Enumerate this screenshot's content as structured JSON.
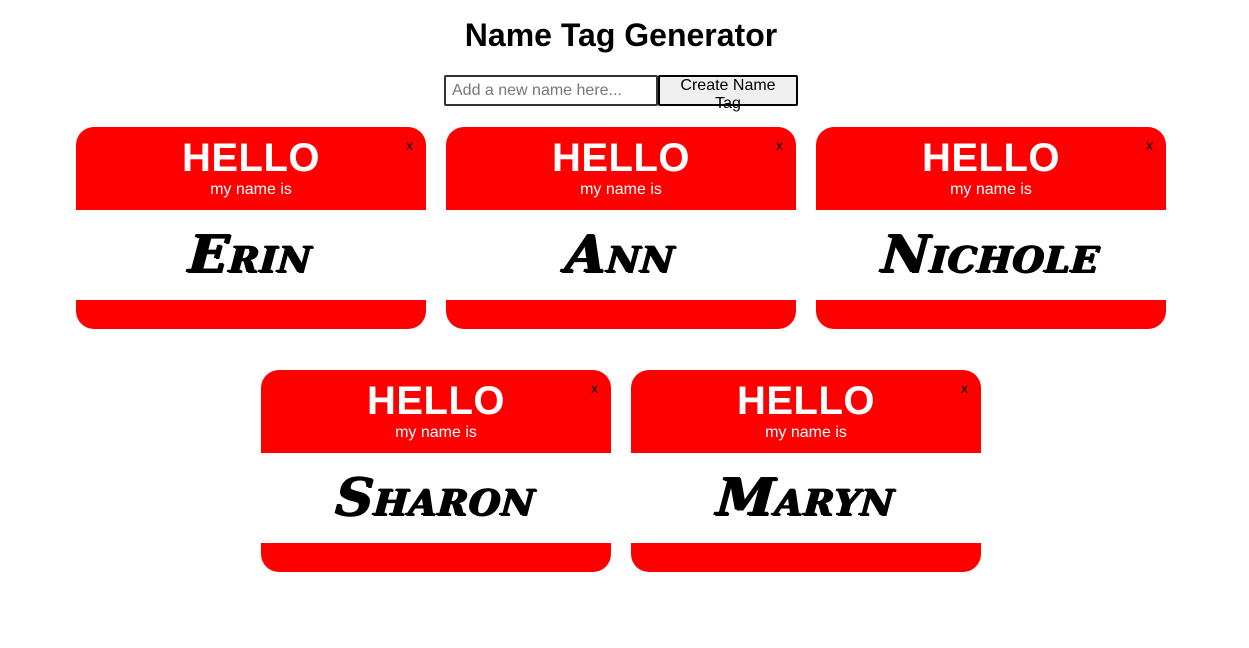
{
  "header": {
    "title": "Name Tag Generator"
  },
  "form": {
    "input_value": "",
    "input_placeholder": "Add a new name here...",
    "create_label": "Create Name Tag"
  },
  "tag_template": {
    "hello": "HELLO",
    "subtitle": "my name is",
    "remove_label": "x"
  },
  "colors": {
    "tag_red": "#ff0000",
    "tag_text": "#ffffff",
    "name_text": "#000000"
  },
  "tags": [
    {
      "name": "Erin"
    },
    {
      "name": "Ann"
    },
    {
      "name": "Nichole"
    },
    {
      "name": "Sharon"
    },
    {
      "name": "Maryn"
    }
  ]
}
